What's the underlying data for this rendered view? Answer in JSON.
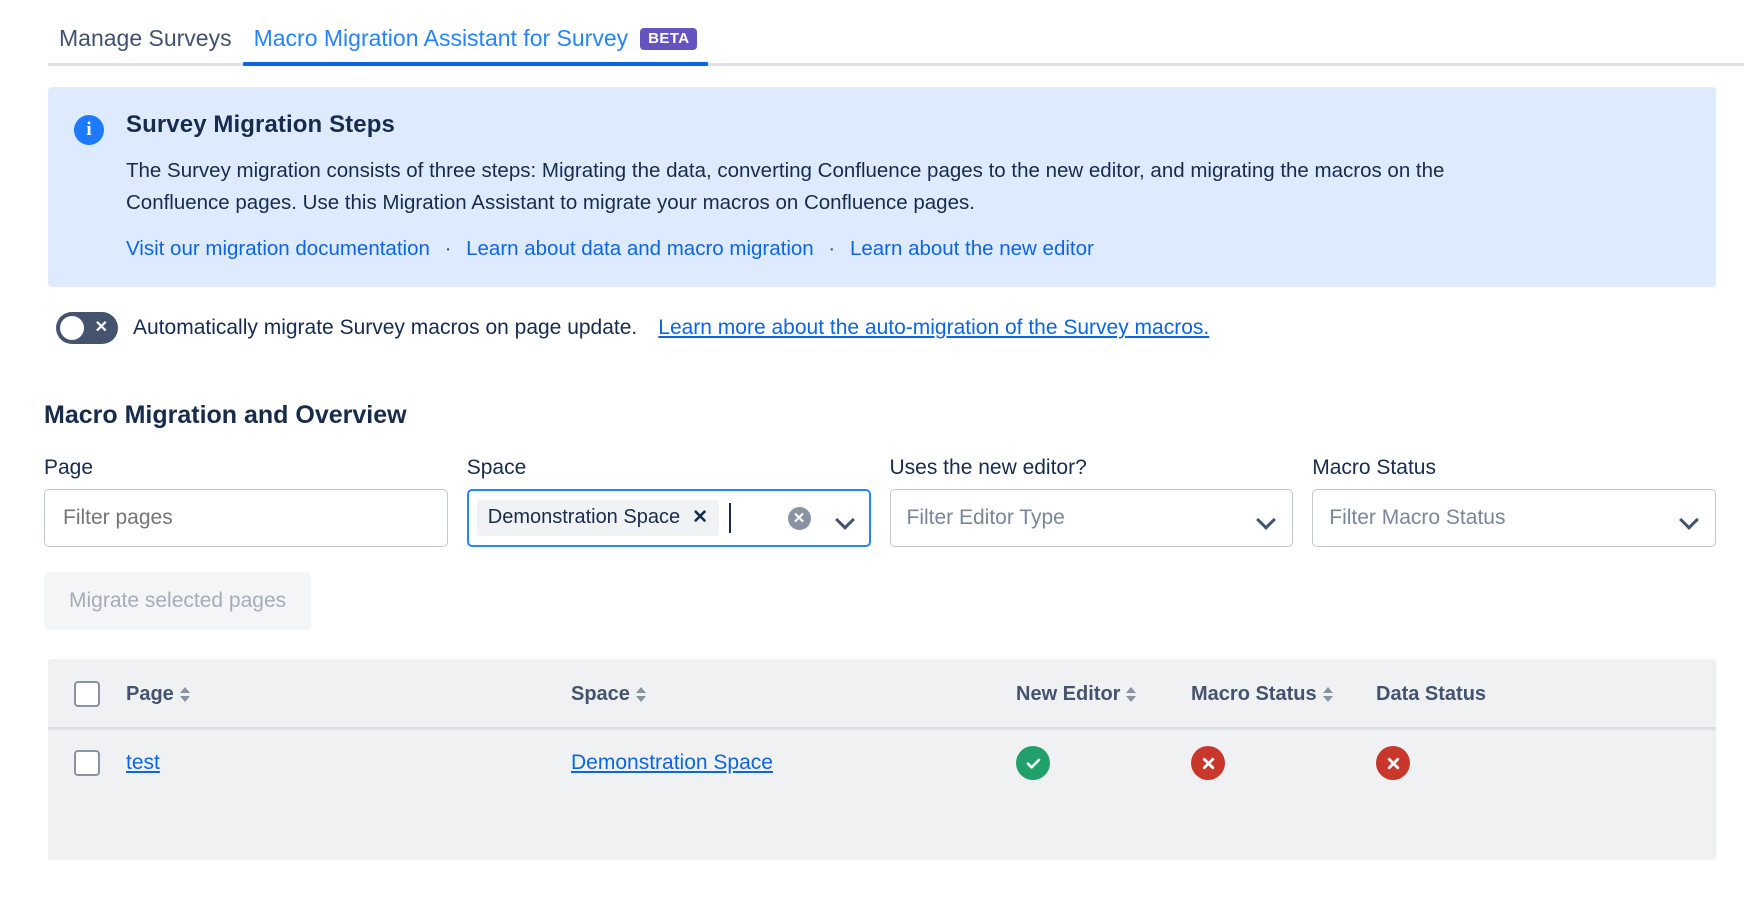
{
  "tabs": [
    {
      "label": "Manage Surveys",
      "active": false
    },
    {
      "label": "Macro Migration Assistant for Survey",
      "active": true,
      "badge": "BETA"
    }
  ],
  "banner": {
    "icon": "info-icon",
    "title": "Survey Migration Steps",
    "text": "The Survey migration consists of three steps: Migrating the data, converting Confluence pages to the new editor, and migrating the macros on the Confluence pages. Use this Migration Assistant to migrate your macros on Confluence pages.",
    "links": [
      "Visit our migration documentation",
      "Learn about data and macro migration",
      "Learn about the new editor"
    ],
    "separator": "·",
    "background": "#deebff",
    "icon_color": "#1d7afc"
  },
  "auto_migrate": {
    "enabled": false,
    "toggle_mark": "✕",
    "label": "Automatically migrate Survey macros on page update.",
    "link": "Learn more about the auto-migration of the Survey macros."
  },
  "section": {
    "title": "Macro Migration and Overview"
  },
  "filters": {
    "page": {
      "label": "Page",
      "placeholder": "Filter pages",
      "value": ""
    },
    "space": {
      "label": "Space",
      "focused": true,
      "tags": [
        "Demonstration Space"
      ],
      "tag_remove": "✕",
      "clear_icon": "clear-circle-icon",
      "chevron": "chevron-down-icon"
    },
    "editor": {
      "label": "Uses the new editor?",
      "placeholder": "Filter Editor Type",
      "chevron": "chevron-down-icon"
    },
    "macro_status": {
      "label": "Macro Status",
      "placeholder": "Filter Macro Status",
      "chevron": "chevron-down-icon"
    }
  },
  "actions": {
    "migrate_label": "Migrate selected pages",
    "migrate_disabled": true
  },
  "table": {
    "select_all_checked": false,
    "columns": [
      {
        "key": "check",
        "label": "",
        "sortable": false
      },
      {
        "key": "page",
        "label": "Page",
        "sortable": true
      },
      {
        "key": "space",
        "label": "Space",
        "sortable": true
      },
      {
        "key": "editor",
        "label": "New Editor",
        "sortable": true
      },
      {
        "key": "macro",
        "label": "Macro Status",
        "sortable": true
      },
      {
        "key": "data",
        "label": "Data Status",
        "sortable": false
      }
    ],
    "rows": [
      {
        "checked": false,
        "page": "test",
        "space": "Demonstration Space",
        "new_editor": "ok",
        "macro_status": "bad",
        "data_status": "bad"
      }
    ]
  },
  "colors": {
    "accent_link": "#0c66e4",
    "tab_active": "#2684ff",
    "beta_badge": "#6554c0",
    "status_ok": "#22a06b",
    "status_bad": "#c9372c",
    "table_bg": "#f0f1f3"
  }
}
